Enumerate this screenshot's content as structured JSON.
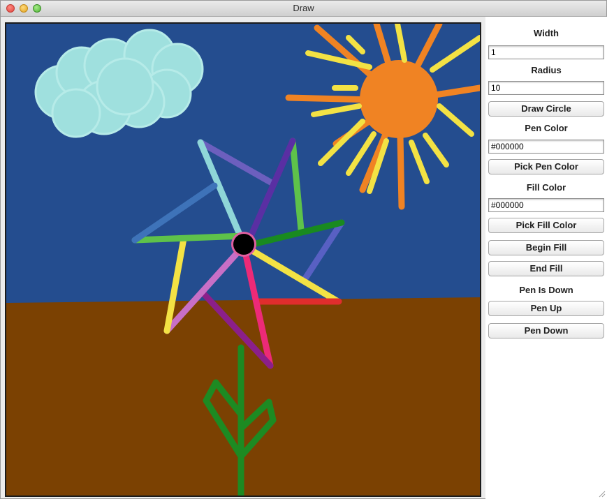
{
  "window": {
    "title": "Draw"
  },
  "panel": {
    "width_label": "Width",
    "width_value": "1",
    "radius_label": "Radius",
    "radius_value": "10",
    "draw_circle_label": "Draw Circle",
    "pen_color_label": "Pen Color",
    "pen_color_value": "#000000",
    "pick_pen_color_label": "Pick Pen Color",
    "fill_color_label": "Fill Color",
    "fill_color_value": "#000000",
    "pick_fill_color_label": "Pick Fill Color",
    "begin_fill_label": "Begin Fill",
    "end_fill_label": "End Fill",
    "pen_status": "Pen Is Down",
    "pen_up_label": "Pen Up",
    "pen_down_label": "Pen Down"
  },
  "colors": {
    "sky": "#244d8f",
    "ground": "#7b4102",
    "sun": "#f08323",
    "sun_rays_short": "#f3e244",
    "cloud": "#9fe0de",
    "stem": "#1d8a22",
    "center": "#000000"
  }
}
